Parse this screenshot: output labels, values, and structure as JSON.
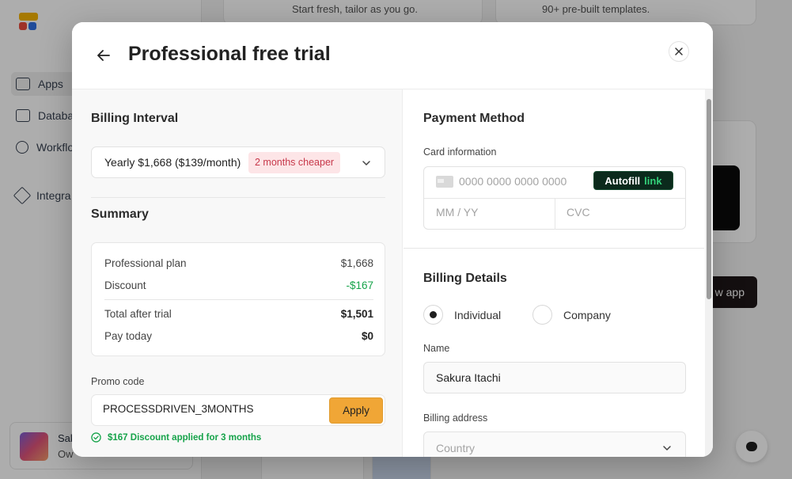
{
  "background": {
    "sidebar": {
      "items": [
        {
          "label": "Apps",
          "icon": "panel-icon",
          "active": true
        },
        {
          "label": "Databa",
          "icon": "table-icon"
        },
        {
          "label": "Workflo",
          "icon": "branch-icon"
        },
        {
          "label": "Integra",
          "icon": "plug-icon"
        }
      ],
      "user": {
        "name": "Sak",
        "role": "Ow"
      }
    },
    "cards": [
      {
        "text": "Start fresh, tailor as you go."
      },
      {
        "text": "90+ pre-built templates."
      }
    ],
    "new_app_button": "w app"
  },
  "modal": {
    "title": "Professional free trial",
    "billing_interval": {
      "title": "Billing Interval",
      "selected": "Yearly $1,668 ($139/month)",
      "badge": "2 months cheaper"
    },
    "summary": {
      "title": "Summary",
      "rows": [
        {
          "label": "Professional plan",
          "value": "$1,668"
        },
        {
          "label": "Discount",
          "value": "-$167"
        },
        {
          "label": "Total after trial",
          "value": "$1,501"
        },
        {
          "label": "Pay today",
          "value": "$0"
        }
      ]
    },
    "promo": {
      "label": "Promo code",
      "value": "PROCESSDRIVEN_3MONTHS",
      "apply_label": "Apply",
      "message": "$167 Discount applied for 3 months"
    },
    "payment": {
      "title": "Payment Method",
      "card_label": "Card information",
      "card_number_placeholder": "0000 0000 0000 0000",
      "expiry_placeholder": "MM / YY",
      "cvc_placeholder": "CVC",
      "autofill_label": "Autofill",
      "autofill_link": "link"
    },
    "billing_details": {
      "title": "Billing Details",
      "options": [
        {
          "label": "Individual",
          "selected": true
        },
        {
          "label": "Company",
          "selected": false
        }
      ],
      "name_label": "Name",
      "name_value": "Sakura Itachi",
      "address_label": "Billing address",
      "country_placeholder": "Country"
    }
  },
  "colors": {
    "accent": "#f0a636",
    "success": "#16a34a",
    "badge_bg": "#fde5e7",
    "badge_text": "#c7384a",
    "link_green": "#33d17a"
  }
}
